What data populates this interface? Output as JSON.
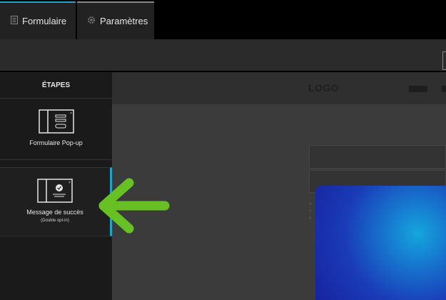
{
  "tabs": [
    {
      "label": "Formulaire",
      "icon": "document-icon"
    },
    {
      "label": "Paramètres",
      "icon": "gear-icon"
    }
  ],
  "sidebar": {
    "title": "ÉTAPES",
    "steps": [
      {
        "label": "Formulaire Pop-up",
        "icon": "popup-form-icon"
      },
      {
        "label": "Message de succès",
        "sublabel": "(Double opt-in)",
        "icon": "success-message-icon"
      }
    ]
  },
  "preview": {
    "logo": "LOGO"
  },
  "colors": {
    "accent": "#1fa3c7",
    "arrow": "#67c124"
  }
}
